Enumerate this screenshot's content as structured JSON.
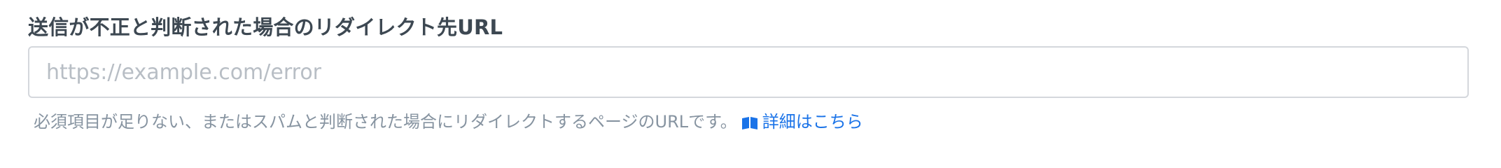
{
  "form": {
    "redirect_error": {
      "label": "送信が不正と判断された場合のリダイレクト先URL",
      "input_value": "",
      "placeholder": "https://example.com/error",
      "help_text": "必須項目が足りない、またはスパムと判断された場合にリダイレクトするページのURLです。",
      "help_link_label": "詳細はこちら",
      "help_link_icon": "book-icon"
    }
  },
  "colors": {
    "label": "#3d4852",
    "help_text": "#8794a1",
    "link": "#1a73e8",
    "input_border": "#d4d7dc",
    "placeholder": "#b8bec5"
  }
}
